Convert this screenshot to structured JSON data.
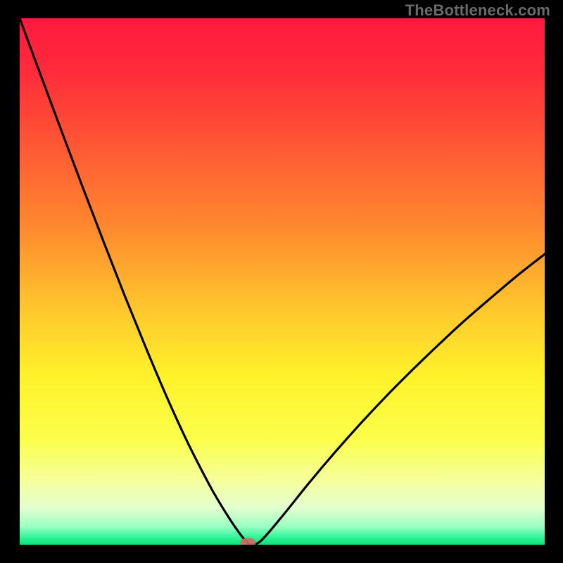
{
  "watermark": "TheBottleneck.com",
  "chart_data": {
    "type": "line",
    "title": "",
    "xlabel": "",
    "ylabel": "",
    "xlim": [
      0,
      100
    ],
    "ylim": [
      0,
      100
    ],
    "x": [
      0,
      4,
      8,
      12,
      16,
      20,
      24,
      28,
      32,
      36,
      38,
      40,
      41,
      42,
      43,
      44,
      46,
      50,
      55,
      60,
      65,
      70,
      75,
      80,
      85,
      90,
      95,
      100
    ],
    "values": [
      100,
      89.2,
      78.5,
      67.9,
      57.5,
      47.3,
      37.5,
      28.1,
      19.4,
      11.6,
      8.1,
      4.9,
      3.4,
      2.0,
      0.8,
      0.0,
      0.8,
      5.4,
      11.6,
      17.5,
      23.1,
      28.4,
      33.4,
      38.2,
      42.8,
      47.1,
      51.3,
      55.2
    ],
    "marker": {
      "x": 43.5,
      "y": 0
    },
    "gradient_stops": [
      {
        "offset": 0.0,
        "color": "#ff1a3f"
      },
      {
        "offset": 0.1,
        "color": "#ff2b3b"
      },
      {
        "offset": 0.25,
        "color": "#ff5a33"
      },
      {
        "offset": 0.4,
        "color": "#ff8a2e"
      },
      {
        "offset": 0.55,
        "color": "#ffc62d"
      },
      {
        "offset": 0.68,
        "color": "#fff22a"
      },
      {
        "offset": 0.8,
        "color": "#fbff4a"
      },
      {
        "offset": 0.88,
        "color": "#f4ff9e"
      },
      {
        "offset": 0.93,
        "color": "#e3ffcf"
      },
      {
        "offset": 0.965,
        "color": "#9bffc2"
      },
      {
        "offset": 0.985,
        "color": "#35f59a"
      },
      {
        "offset": 1.0,
        "color": "#0be276"
      }
    ]
  }
}
